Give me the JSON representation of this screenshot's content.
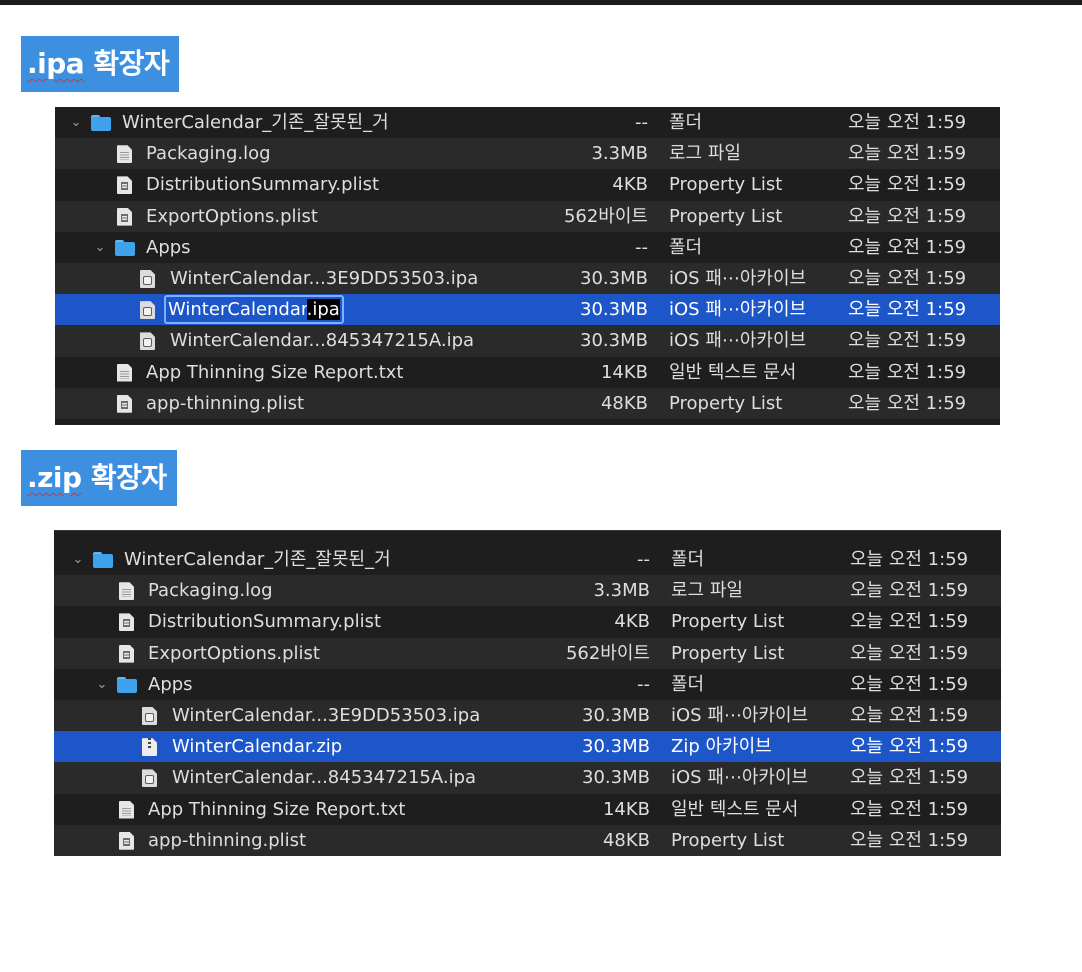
{
  "headings": {
    "ipa": {
      "ext": ".ipa",
      "label": " 확장자"
    },
    "zip": {
      "ext": ".zip",
      "label": " 확장자"
    }
  },
  "colors": {
    "heading_bg": "#3d8fe0",
    "selection": "#1c56c9",
    "finder_bg": "#1e1e1e",
    "folder": "#3fa2ec"
  },
  "ipa_list": {
    "root": {
      "name": "WinterCalendar_기존_잘못된_거",
      "size": "--",
      "kind": "폴더",
      "date": "오늘 오전 1:59",
      "icon": "folder-icon"
    },
    "packaging": {
      "name": "Packaging.log",
      "size": "3.3MB",
      "kind": "로그 파일",
      "date": "오늘 오전 1:59",
      "icon": "document-icon"
    },
    "distribution": {
      "name": "DistributionSummary.plist",
      "size": "4KB",
      "kind": "Property List",
      "date": "오늘 오전 1:59",
      "icon": "plist-icon"
    },
    "export": {
      "name": "ExportOptions.plist",
      "size": "562바이트",
      "kind": "Property List",
      "date": "오늘 오전 1:59",
      "icon": "plist-icon"
    },
    "apps": {
      "name": "Apps",
      "size": "--",
      "kind": "폴더",
      "date": "오늘 오전 1:59",
      "icon": "folder-icon"
    },
    "ipa1": {
      "name": "WinterCalendar...3E9DD53503.ipa",
      "size": "30.3MB",
      "kind": "iOS 패⋯아카이브",
      "date": "오늘 오전 1:59",
      "icon": "ipa-icon"
    },
    "ipa2": {
      "name_base": "WinterCalendar",
      "name_sel": ".ipa",
      "size": "30.3MB",
      "kind": "iOS 패⋯아카이브",
      "date": "오늘 오전 1:59",
      "icon": "ipa-icon"
    },
    "ipa3": {
      "name": "WinterCalendar...845347215A.ipa",
      "size": "30.3MB",
      "kind": "iOS 패⋯아카이브",
      "date": "오늘 오전 1:59",
      "icon": "ipa-icon"
    },
    "thinning_report": {
      "name": "App Thinning Size Report.txt",
      "size": "14KB",
      "kind": "일반 텍스트 문서",
      "date": "오늘 오전 1:59",
      "icon": "document-icon"
    },
    "thinning_plist": {
      "name": "app-thinning.plist",
      "size": "48KB",
      "kind": "Property List",
      "date": "오늘 오전 1:59",
      "icon": "plist-icon"
    }
  },
  "zip_list": {
    "root": {
      "name": "WinterCalendar_기존_잘못된_거",
      "size": "--",
      "kind": "폴더",
      "date": "오늘 오전 1:59",
      "icon": "folder-icon"
    },
    "packaging": {
      "name": "Packaging.log",
      "size": "3.3MB",
      "kind": "로그 파일",
      "date": "오늘 오전 1:59",
      "icon": "document-icon"
    },
    "distribution": {
      "name": "DistributionSummary.plist",
      "size": "4KB",
      "kind": "Property List",
      "date": "오늘 오전 1:59",
      "icon": "plist-icon"
    },
    "export": {
      "name": "ExportOptions.plist",
      "size": "562바이트",
      "kind": "Property List",
      "date": "오늘 오전 1:59",
      "icon": "plist-icon"
    },
    "apps": {
      "name": "Apps",
      "size": "--",
      "kind": "폴더",
      "date": "오늘 오전 1:59",
      "icon": "folder-icon"
    },
    "ipa1": {
      "name": "WinterCalendar...3E9DD53503.ipa",
      "size": "30.3MB",
      "kind": "iOS 패⋯아카이브",
      "date": "오늘 오전 1:59",
      "icon": "ipa-icon"
    },
    "zip": {
      "name": "WinterCalendar.zip",
      "size": "30.3MB",
      "kind": "Zip 아카이브",
      "date": "오늘 오전 1:59",
      "icon": "zip-icon"
    },
    "ipa3": {
      "name": "WinterCalendar...845347215A.ipa",
      "size": "30.3MB",
      "kind": "iOS 패⋯아카이브",
      "date": "오늘 오전 1:59",
      "icon": "ipa-icon"
    },
    "thinning_report": {
      "name": "App Thinning Size Report.txt",
      "size": "14KB",
      "kind": "일반 텍스트 문서",
      "date": "오늘 오전 1:59",
      "icon": "document-icon"
    },
    "thinning_plist": {
      "name": "app-thinning.plist",
      "size": "48KB",
      "kind": "Property List",
      "date": "오늘 오전 1:59",
      "icon": "plist-icon"
    }
  }
}
